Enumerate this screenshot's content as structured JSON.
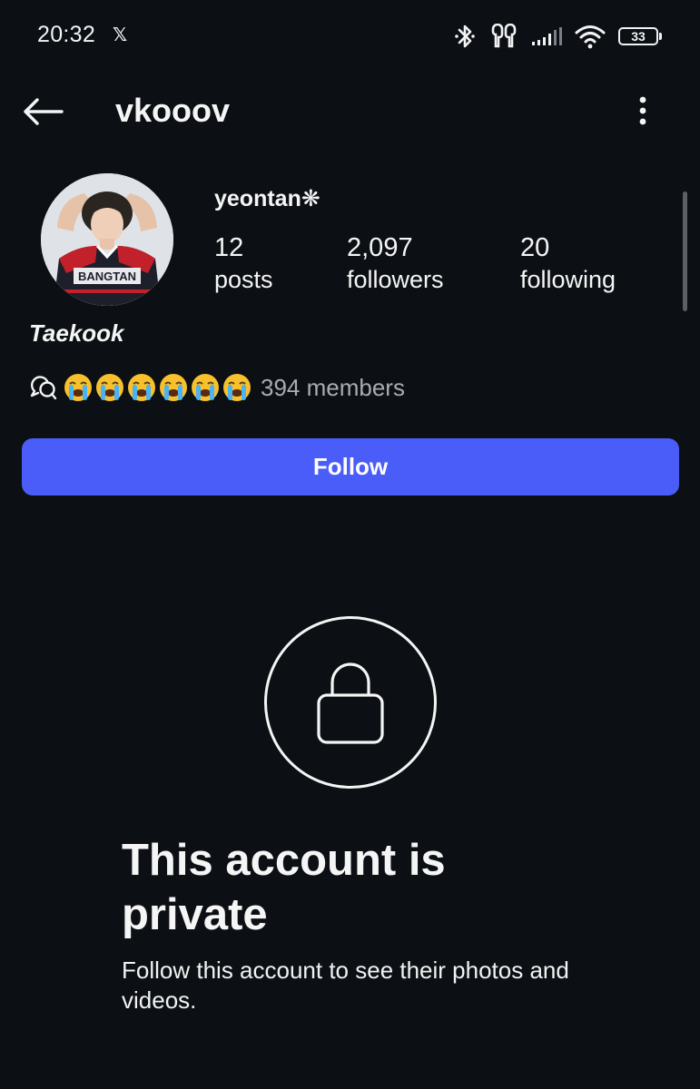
{
  "status_bar": {
    "time": "20:32",
    "notification_icon": "x-logo",
    "battery_level": "33",
    "icons": [
      "bluetooth-icon",
      "earbuds-icon",
      "signal-icon",
      "wifi-icon",
      "battery-icon"
    ]
  },
  "header": {
    "username": "vkooov",
    "back_icon": "arrow-left-icon",
    "more_icon": "more-vertical-icon"
  },
  "profile": {
    "display_name": "yeontan❋",
    "stats": {
      "posts_count": "12",
      "posts_label": "posts",
      "followers_count": "2,097",
      "followers_label": "followers",
      "following_count": "20",
      "following_label": "following"
    },
    "bio_name": "Taekook",
    "channel": {
      "icon": "chat-bubbles-icon",
      "emojis": "😭😭😭😭😭😭",
      "members": "394 members"
    }
  },
  "actions": {
    "follow_label": "Follow"
  },
  "private_notice": {
    "icon": "lock-icon",
    "title": "This account is private",
    "subtitle": "Follow this account to see their photos and videos."
  },
  "colors": {
    "background": "#0c1014",
    "accent": "#4a5df9",
    "text": "#f5f5f5",
    "muted": "#a8acb3"
  }
}
